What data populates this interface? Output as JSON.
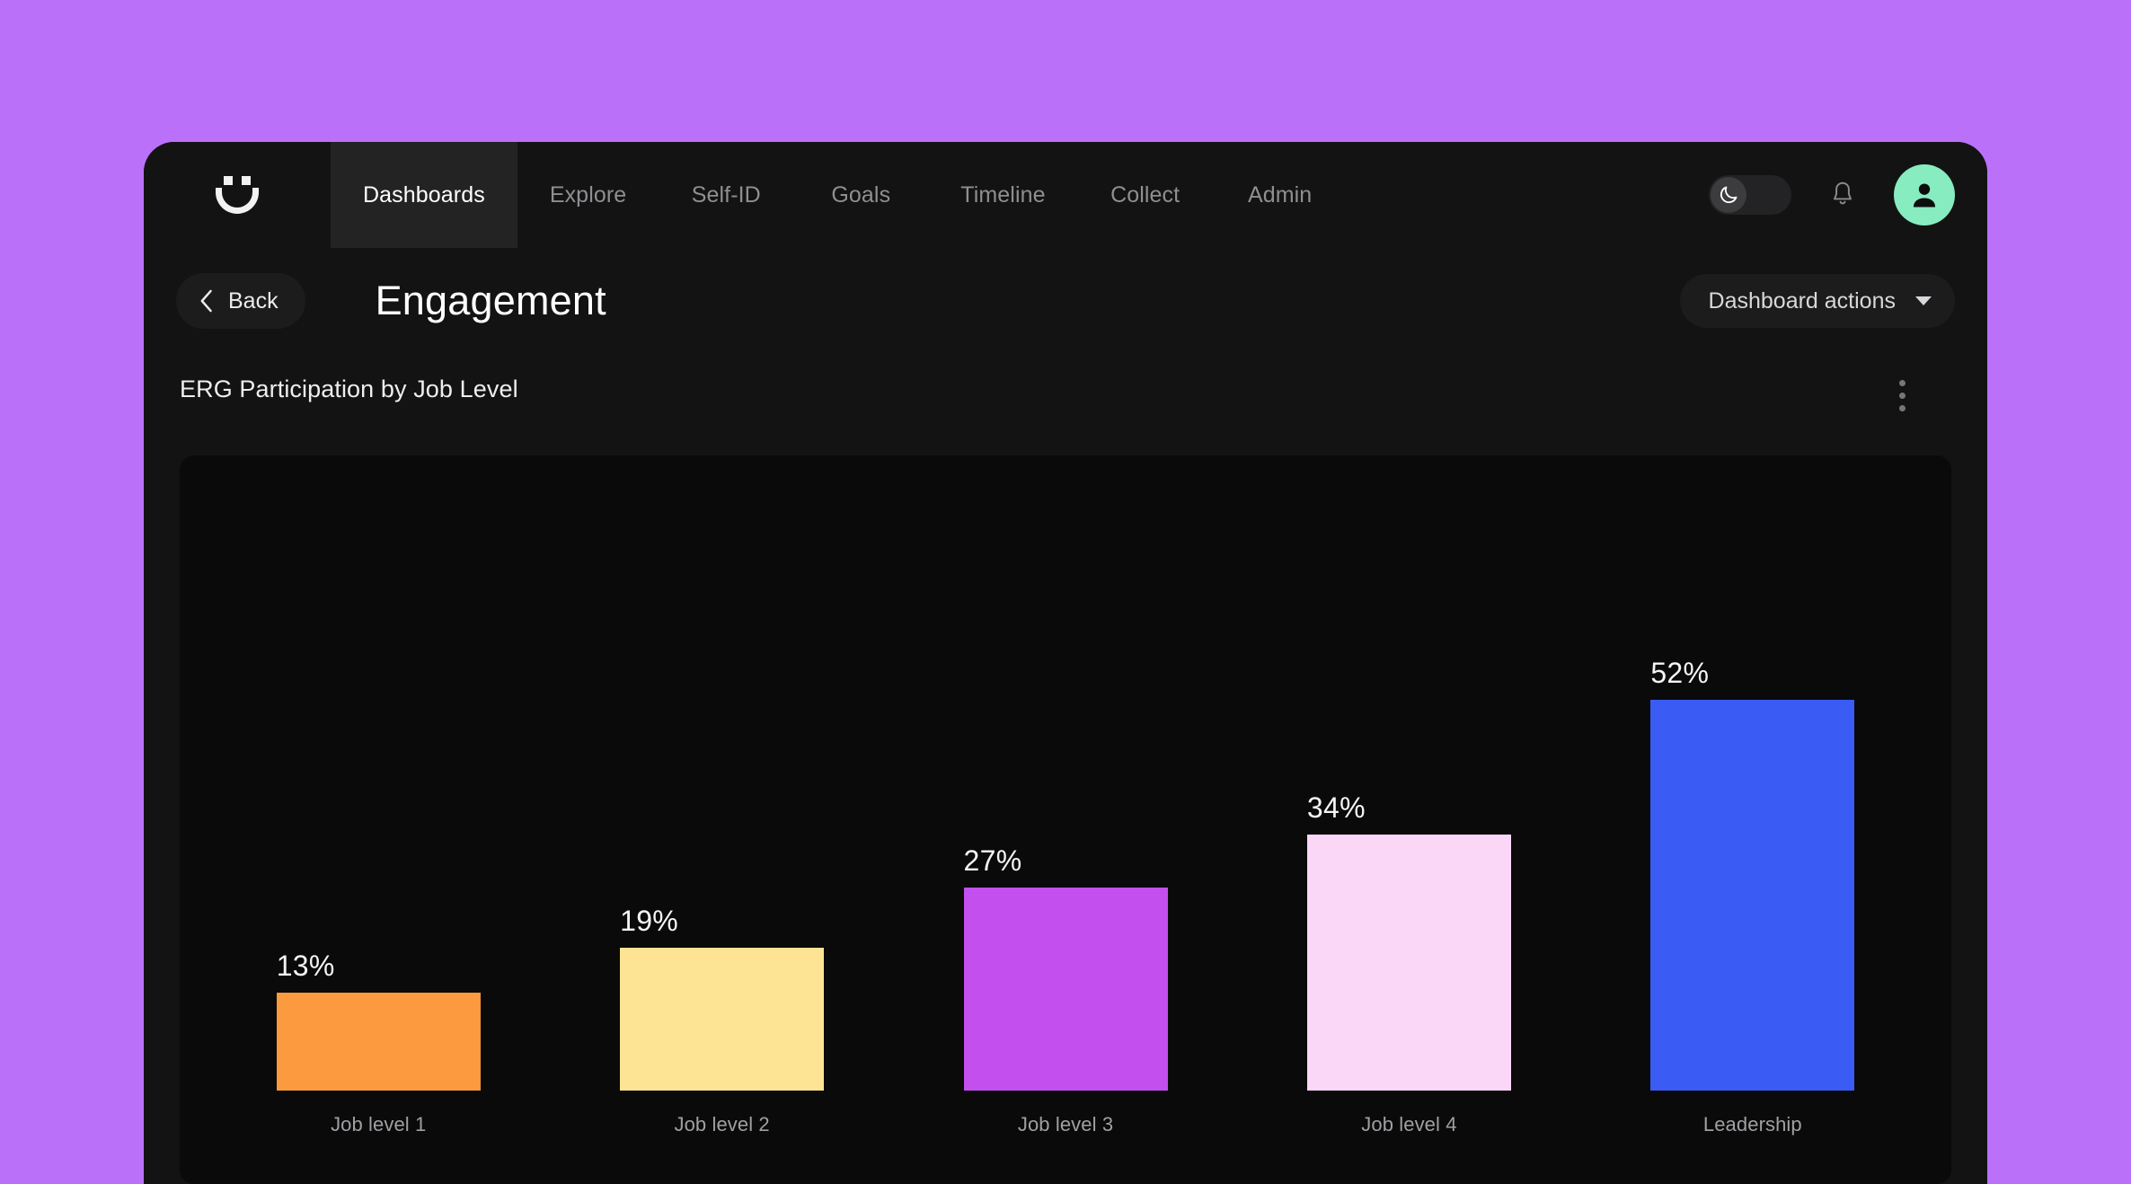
{
  "theme": {
    "page_background": "#bb70fa",
    "window_background": "#131313",
    "panel_background": "#0a0a0a",
    "accent_avatar": "#87ecc0",
    "active_tab_background": "#232323"
  },
  "topnav": {
    "logo_name": "Culture Amp smiley logo",
    "tabs": [
      {
        "label": "Dashboards",
        "active": true
      },
      {
        "label": "Explore",
        "active": false
      },
      {
        "label": "Self-ID",
        "active": false
      },
      {
        "label": "Goals",
        "active": false
      },
      {
        "label": "Timeline",
        "active": false
      },
      {
        "label": "Collect",
        "active": false
      },
      {
        "label": "Admin",
        "active": false
      }
    ],
    "dark_mode_toggle": {
      "state": "on",
      "icon": "moon-icon"
    },
    "notifications_icon": "bell-icon",
    "avatar_icon": "person-icon"
  },
  "page_header": {
    "back_label": "Back",
    "back_icon": "chevron-left-icon",
    "title": "Engagement",
    "dashboard_actions_label": "Dashboard actions",
    "dashboard_actions_icon": "chevron-down-icon"
  },
  "chart_card": {
    "title": "ERG Participation by Job Level",
    "menu_icon": "kebab-menu-icon"
  },
  "chart_data": {
    "type": "bar",
    "title": "ERG Participation by Job Level",
    "xlabel": "",
    "ylabel": "",
    "ylim": [
      0,
      100
    ],
    "grid": false,
    "legend": false,
    "unit": "%",
    "categories": [
      "Job level 1",
      "Job level 2",
      "Job level 3",
      "Job level 4",
      "Leadership"
    ],
    "values": [
      13,
      19,
      27,
      34,
      52
    ],
    "value_labels": [
      "13%",
      "19%",
      "27%",
      "34%",
      "52%"
    ],
    "colors": [
      "#fb9a3e",
      "#fce494",
      "#c34fee",
      "#fad6f7",
      "#3a5cf5"
    ]
  }
}
